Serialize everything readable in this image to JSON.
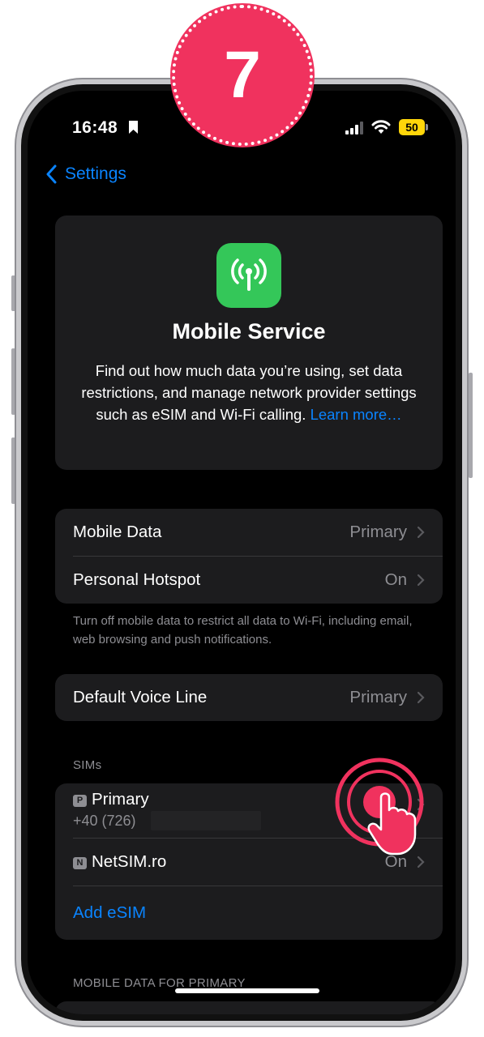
{
  "status_bar": {
    "time": "16:48",
    "battery": "50",
    "battery_color": "#ffd60a"
  },
  "nav": {
    "back_label": "Settings"
  },
  "info_card": {
    "title": "Mobile Service",
    "body": "Find out how much data you’re using, set data restrictions, and manage network provider settings such as eSIM and Wi-Fi calling.",
    "link": "Learn more…",
    "icon": "antenna-icon",
    "icon_color": "#34c759"
  },
  "data_group": {
    "rows": [
      {
        "label": "Mobile Data",
        "value": "Primary"
      },
      {
        "label": "Personal Hotspot",
        "value": "On"
      }
    ],
    "footnote": "Turn off mobile data to restrict all data to Wi-Fi, including email, web browsing and push notifications."
  },
  "voice_group": {
    "rows": [
      {
        "label": "Default Voice Line",
        "value": "Primary"
      }
    ]
  },
  "sims": {
    "header": "SIMs",
    "items": [
      {
        "badge": "P",
        "label": "Primary",
        "number": "+40 (726)"
      },
      {
        "badge": "N",
        "label": "NetSIM.ro",
        "value": "On"
      }
    ],
    "add_label": "Add eSIM"
  },
  "mobile_data_section": {
    "header": "MOBILE DATA FOR PRIMARY"
  },
  "tutorial": {
    "step": "7",
    "accent": "#f0325e"
  }
}
